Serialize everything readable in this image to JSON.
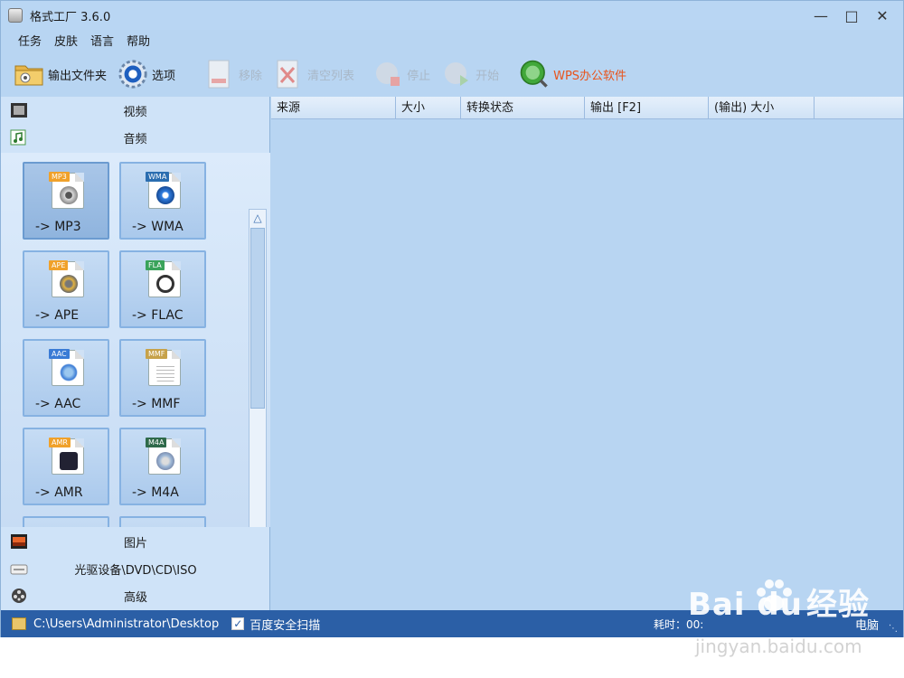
{
  "window": {
    "title": "格式工厂 3.6.0"
  },
  "menu": [
    "任务",
    "皮肤",
    "语言",
    "帮助"
  ],
  "toolbar": {
    "output_folder": "输出文件夹",
    "options": "选项",
    "remove": "移除",
    "clear_list": "清空列表",
    "stop": "停止",
    "start": "开始",
    "wps": "WPS办公软件"
  },
  "categories": {
    "video": "视频",
    "audio": "音频",
    "picture": "图片",
    "optical": "光驱设备\\DVD\\CD\\ISO",
    "advanced": "高级"
  },
  "audio_tiles": [
    {
      "tag": "MP3",
      "label": "-> MP3",
      "color": "#f0a12a"
    },
    {
      "tag": "WMA",
      "label": "-> WMA",
      "color": "#2a6db0"
    },
    {
      "tag": "APE",
      "label": "-> APE",
      "color": "#f0a12a"
    },
    {
      "tag": "FLA",
      "label": "-> FLAC",
      "color": "#3aa35a"
    },
    {
      "tag": "AAC",
      "label": "-> AAC",
      "color": "#3a7bd5"
    },
    {
      "tag": "MMF",
      "label": "-> MMF",
      "color": "#c7a24a"
    },
    {
      "tag": "AMR",
      "label": "-> AMR",
      "color": "#f0a12a"
    },
    {
      "tag": "M4A",
      "label": "-> M4A",
      "color": "#2f6a4a"
    }
  ],
  "table": {
    "columns": [
      "来源",
      "大小",
      "转换状态",
      "输出 [F2]",
      "(输出) 大小",
      ""
    ]
  },
  "status": {
    "path": "C:\\Users\\Administrator\\Desktop",
    "scan_label": "百度安全扫描",
    "scan_checked": true,
    "elapsed": "耗时：00:",
    "shutdown": "电脑"
  },
  "watermark": {
    "brand": "Bai  du",
    "brand_cn": "经验",
    "site": "jingyan.baidu.com"
  }
}
